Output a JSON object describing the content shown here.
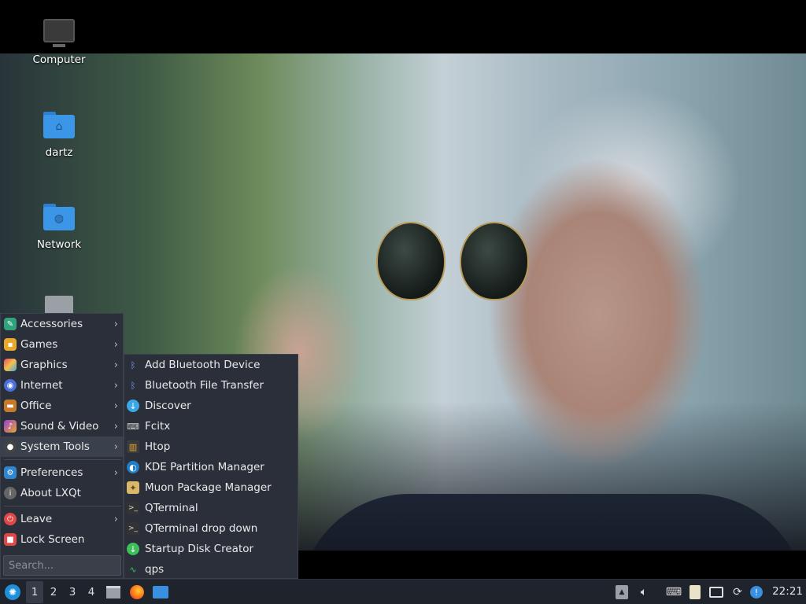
{
  "desktop": {
    "icons": [
      {
        "label": "Computer",
        "icon": "computer-icon"
      },
      {
        "label": "dartz",
        "icon": "home-folder-icon"
      },
      {
        "label": "Network",
        "icon": "network-folder-icon"
      },
      {
        "label": "",
        "icon": "trash-icon"
      }
    ]
  },
  "start_menu": {
    "items": [
      {
        "label": "Accessories",
        "icon": "accessories-icon",
        "submenu": true
      },
      {
        "label": "Games",
        "icon": "games-icon",
        "submenu": true
      },
      {
        "label": "Graphics",
        "icon": "graphics-icon",
        "submenu": true
      },
      {
        "label": "Internet",
        "icon": "internet-icon",
        "submenu": true
      },
      {
        "label": "Office",
        "icon": "office-icon",
        "submenu": true
      },
      {
        "label": "Sound & Video",
        "icon": "sound-video-icon",
        "submenu": true
      },
      {
        "label": "System Tools",
        "icon": "system-tools-icon",
        "submenu": true
      },
      {
        "label": "Preferences",
        "icon": "preferences-icon",
        "submenu": true
      },
      {
        "label": "About LXQt",
        "icon": "info-icon",
        "submenu": false
      },
      {
        "label": "Leave",
        "icon": "power-icon",
        "submenu": true
      },
      {
        "label": "Lock Screen",
        "icon": "lock-icon",
        "submenu": false
      }
    ],
    "search_placeholder": "Search...",
    "arrow": "›"
  },
  "submenu": {
    "parent": "System Tools",
    "items": [
      {
        "label": "Add Bluetooth Device",
        "icon": "bluetooth-icon"
      },
      {
        "label": "Bluetooth File Transfer",
        "icon": "bluetooth-icon"
      },
      {
        "label": "Discover",
        "icon": "discover-icon"
      },
      {
        "label": "Fcitx",
        "icon": "keyboard-icon"
      },
      {
        "label": "Htop",
        "icon": "htop-icon"
      },
      {
        "label": "KDE Partition Manager",
        "icon": "partition-manager-icon"
      },
      {
        "label": "Muon Package Manager",
        "icon": "package-manager-icon"
      },
      {
        "label": "QTerminal",
        "icon": "terminal-icon"
      },
      {
        "label": "QTerminal drop down",
        "icon": "terminal-icon"
      },
      {
        "label": "Startup Disk Creator",
        "icon": "disk-creator-icon"
      },
      {
        "label": "qps",
        "icon": "process-monitor-icon"
      }
    ]
  },
  "taskbar": {
    "workspaces": [
      "1",
      "2",
      "3",
      "4"
    ],
    "current_workspace": "1",
    "clock": "22:21",
    "launchers": [
      "file-manager-icon",
      "firefox-icon",
      "show-desktop-icon"
    ],
    "tray": [
      "tray-up-arrow-icon",
      "volume-icon",
      "keyboard-icon",
      "clipboard-icon",
      "network-icon",
      "update-icon",
      "notification-icon"
    ]
  },
  "colors": {
    "panel_bg": "#1f232c",
    "menu_bg": "#2a2f3a",
    "accent": "#3c96e8"
  }
}
